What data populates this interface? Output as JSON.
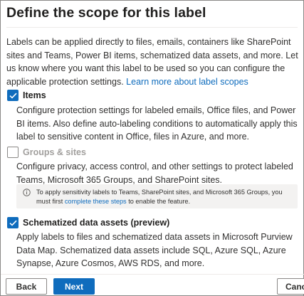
{
  "title": "Define the scope for this label",
  "intro": {
    "text": "Labels can be applied directly to files, emails, containers like SharePoint sites and Teams, Power BI items, schematized data assets, and more. Let us know where you want this label to be used so you can configure the applicable protection settings. ",
    "link": "Learn more about label scopes"
  },
  "options": [
    {
      "label": "Items",
      "checked": true,
      "enabled": true,
      "description": "Configure protection settings for labeled emails, Office files, and Power BI items. Also define auto-labeling conditions to automatically apply this label to sensitive content in Office, files in Azure, and more."
    },
    {
      "label": "Groups & sites",
      "checked": false,
      "enabled": false,
      "description": "Configure privacy, access control, and other settings to protect labeled Teams, Microsoft 365 Groups, and SharePoint sites.",
      "info": {
        "text_before": "To apply sensitivity labels to Teams, SharePoint sites, and Microsoft 365 Groups, you must first ",
        "link": "complete these steps",
        "text_after": " to enable the feature."
      }
    },
    {
      "label": "Schematized data assets (preview)",
      "checked": true,
      "enabled": true,
      "description": "Apply labels to files and schematized data assets in Microsoft Purview Data Map. Schematized data assets include SQL, Azure SQL, Azure Synapse, Azure Cosmos, AWS RDS, and more."
    }
  ],
  "footer": {
    "back_label": "Back",
    "next_label": "Next",
    "cancel_label": "Cancel"
  },
  "colors": {
    "accent": "#0f6cbd",
    "text": "#323130",
    "disabled": "#a19f9d",
    "info_background": "#f3f2f1"
  },
  "icons": {
    "checkbox_checked": "checkmark-icon",
    "info": "info-icon"
  }
}
